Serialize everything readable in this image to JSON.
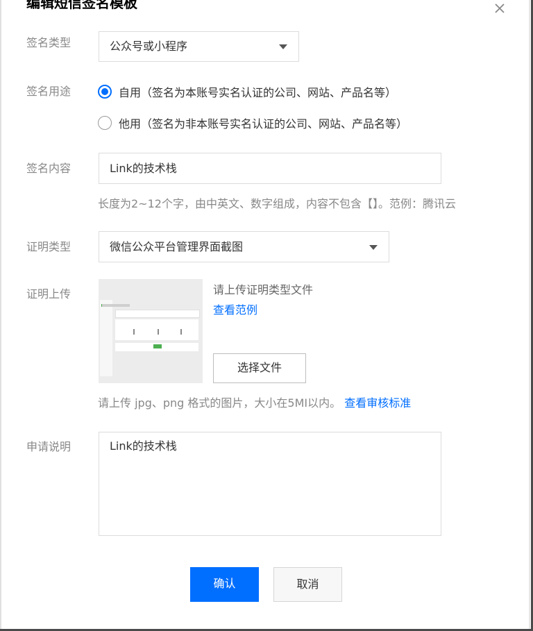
{
  "dialog": {
    "title": "编辑短信签名模板"
  },
  "form": {
    "sign_type": {
      "label": "签名类型",
      "value": "公众号或小程序"
    },
    "sign_usage": {
      "label": "签名用途",
      "options": [
        {
          "label": "自用（签名为本账号实名认证的公司、网站、产品名等）",
          "checked": true
        },
        {
          "label": "他用（签名为非本账号实名认证的公司、网站、产品名等）",
          "checked": false
        }
      ]
    },
    "sign_content": {
      "label": "签名内容",
      "value": "Link的技术栈",
      "hint": "长度为2~12个字，由中英文、数字组成，内容不包含【】。范例：腾讯云"
    },
    "proof_type": {
      "label": "证明类型",
      "value": "微信公众平台管理界面截图"
    },
    "proof_upload": {
      "label": "证明上传",
      "instruction": "请上传证明类型文件",
      "example_link": "查看范例",
      "choose_button": "选择文件",
      "hint": "请上传 jpg、png 格式的图片，大小在5MI以内。",
      "review_link": "查看审核标准"
    },
    "application_note": {
      "label": "申请说明",
      "value": "Link的技术栈"
    }
  },
  "footer": {
    "confirm": "确认",
    "cancel": "取消"
  },
  "colors": {
    "primary": "#006eff",
    "label": "#888888",
    "border": "#dcdcdc"
  },
  "icons": {
    "close": "close-icon",
    "caret": "chevron-down-icon",
    "preview": "screenshot-thumbnail"
  }
}
